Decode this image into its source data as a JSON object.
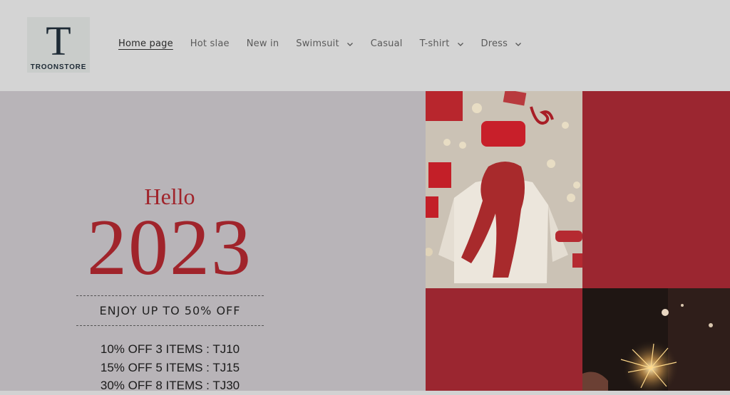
{
  "store": {
    "logo_letter": "T",
    "logo_name": "TROONSTORE"
  },
  "nav": {
    "items": [
      {
        "label": "Home page",
        "dropdown": false,
        "active": true
      },
      {
        "label": "Hot slae",
        "dropdown": false
      },
      {
        "label": "New in",
        "dropdown": false
      },
      {
        "label": "Swimsuit",
        "dropdown": true
      },
      {
        "label": "Casual",
        "dropdown": false
      },
      {
        "label": "T-shirt",
        "dropdown": true
      },
      {
        "label": "Dress",
        "dropdown": true
      }
    ]
  },
  "hero": {
    "greeting": "Hello",
    "year": "2023",
    "headline": "ENJOY UP TO 50% OFF",
    "promos": [
      "10% OFF 3 ITEMS : TJ10",
      "15% OFF 5 ITEMS : TJ15",
      "30% OFF 8 ITEMS : TJ30"
    ]
  },
  "colors": {
    "accent": "#a0242b",
    "tile_red": "#9b2630",
    "header_bg": "#d4d4d4",
    "hero_bg": "#b8b4b8"
  }
}
